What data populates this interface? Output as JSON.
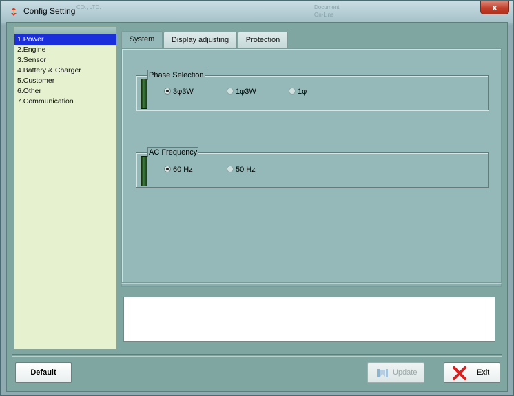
{
  "window": {
    "title": "Config Setting",
    "close_label": "x",
    "background_ghost_text": [
      "Document",
      "On-Line",
      "CO., LTD."
    ]
  },
  "sidebar": {
    "items": [
      {
        "label": "1.Power",
        "selected": true
      },
      {
        "label": "2.Engine"
      },
      {
        "label": "3.Sensor"
      },
      {
        "label": "4.Battery & Charger"
      },
      {
        "label": "5.Customer"
      },
      {
        "label": "6.Other"
      },
      {
        "label": "7.Communication"
      }
    ]
  },
  "tabs": [
    {
      "label": "System",
      "active": true
    },
    {
      "label": "Display adjusting"
    },
    {
      "label": "Protection"
    }
  ],
  "phase_selection": {
    "label": "Phase Selection",
    "options": [
      {
        "label": "3φ3W",
        "checked": true
      },
      {
        "label": "1φ3W"
      },
      {
        "label": "1φ"
      }
    ]
  },
  "ac_frequency": {
    "label": "AC Frequency",
    "options": [
      {
        "label": "60 Hz",
        "checked": true
      },
      {
        "label": "50 Hz"
      }
    ]
  },
  "buttons": {
    "default_label": "Default",
    "update_label": "Update",
    "exit_label": "Exit"
  },
  "colors": {
    "selection": "#1a2edc",
    "panel": "#94b9b8",
    "exit_icon": "#d92020"
  }
}
